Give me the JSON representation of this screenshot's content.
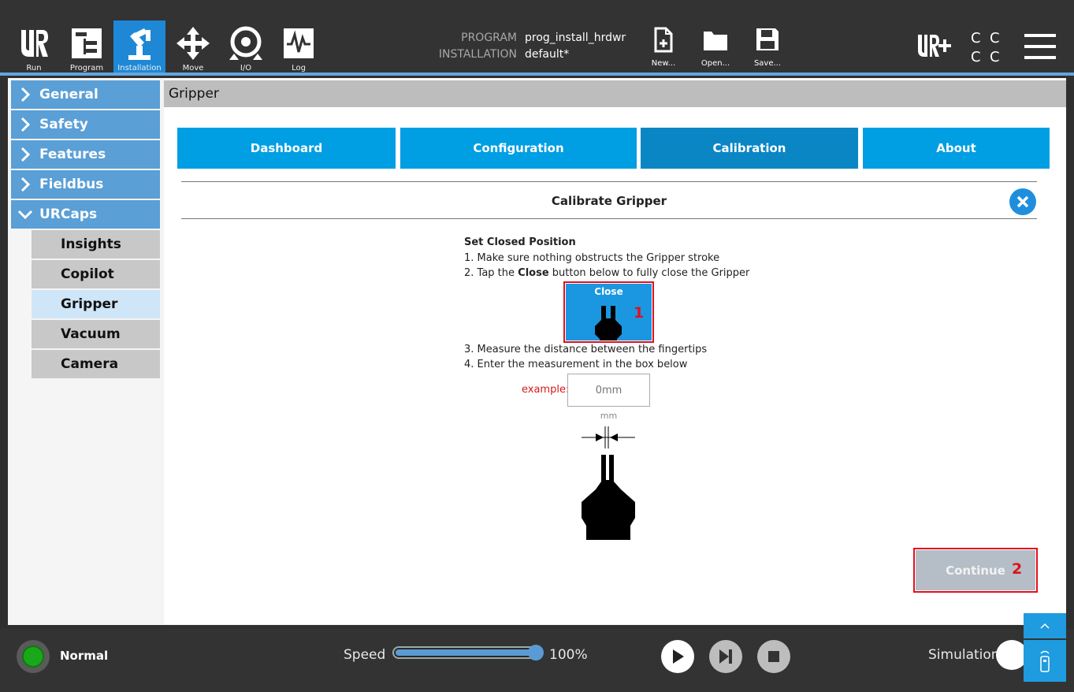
{
  "nav": {
    "run": "Run",
    "program": "Program",
    "installation": "Installation",
    "move": "Move",
    "io": "I/O",
    "log": "Log"
  },
  "header": {
    "program_label": "PROGRAM",
    "program_value": "prog_install_hrdwr",
    "installation_label": "INSTALLATION",
    "installation_value": "default*"
  },
  "file": {
    "new": "New...",
    "open": "Open...",
    "save": "Save..."
  },
  "sidebar": {
    "items": [
      "General",
      "Safety",
      "Features",
      "Fieldbus",
      "URCaps"
    ],
    "sub_items": [
      "Insights",
      "Copilot",
      "Gripper",
      "Vacuum",
      "Camera"
    ],
    "selected": "Gripper"
  },
  "content": {
    "title": "Gripper",
    "tabs": [
      "Dashboard",
      "Configuration",
      "Calibration",
      "About"
    ],
    "active_tab": "Calibration",
    "calibrate_title": "Calibrate Gripper",
    "set_closed": "Set Closed Position",
    "step1": "1. Make sure nothing obstructs the Gripper stroke",
    "step2_pre": "2. Tap the ",
    "step2_bold": "Close",
    "step2_post": " button below to fully close the Gripper",
    "close_button": "Close",
    "step3": "3. Measure the distance between the fingertips",
    "step4": "4. Enter the measurement in the box below",
    "example_label": "example:",
    "input_placeholder": "0mm",
    "unit": "mm",
    "continue_button": "Continue",
    "marker1": "1",
    "marker2": "2"
  },
  "bottom": {
    "status": "Normal",
    "speed_label": "Speed",
    "speed_value": "100%",
    "speed_fraction": 1.0,
    "simulation_label": "Simulation"
  },
  "colors": {
    "accent": "#009ee3",
    "active_tab": "#0a86c5",
    "sidebar": "#5a9fd6",
    "status_ok": "#1aa81a",
    "marker": "#e0101e"
  }
}
